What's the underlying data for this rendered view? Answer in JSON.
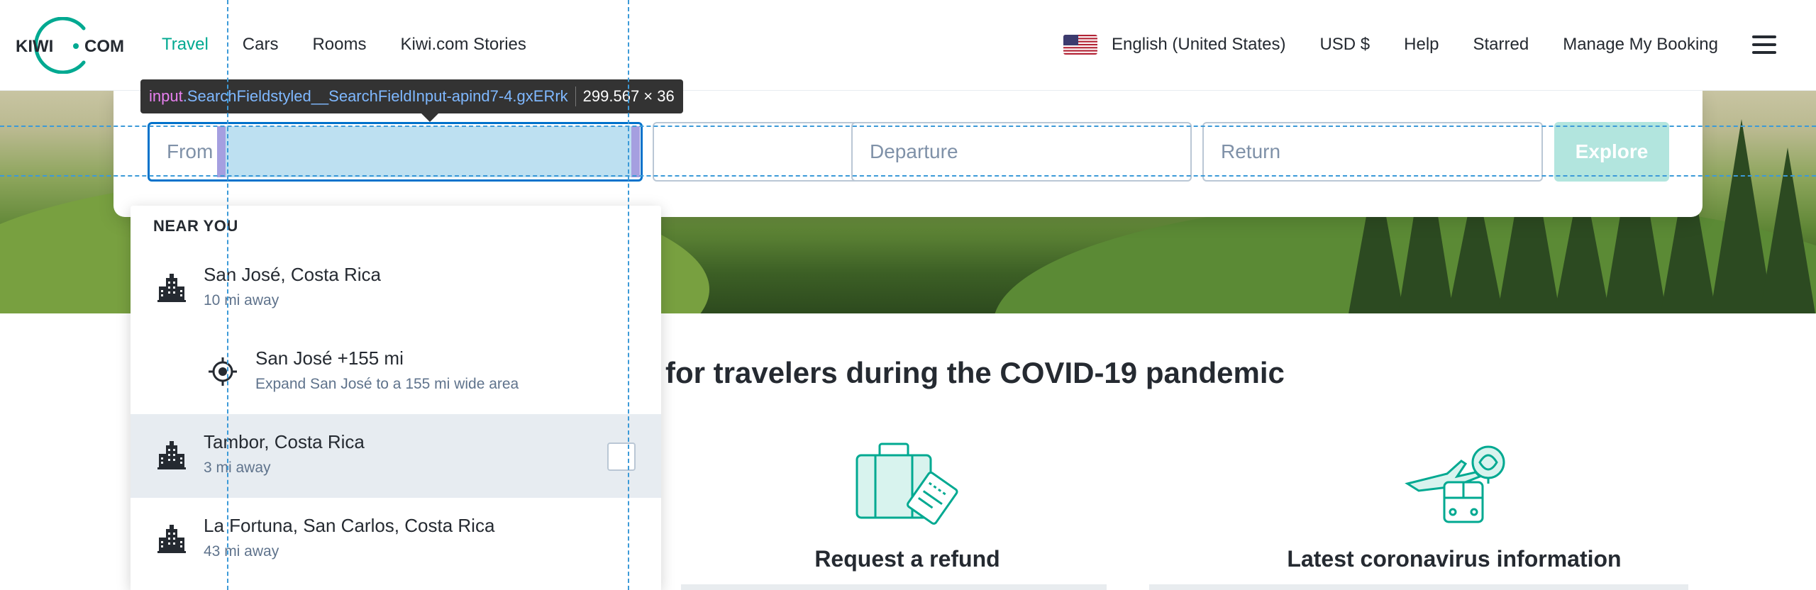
{
  "header": {
    "logo_text_left": "KIWI",
    "logo_text_right": "COM",
    "nav": [
      "Travel",
      "Cars",
      "Rooms",
      "Kiwi.com Stories"
    ],
    "active_nav": "Travel",
    "language": "English (United States)",
    "currency": "USD $",
    "help": "Help",
    "starred": "Starred",
    "manage": "Manage My Booking"
  },
  "search": {
    "from_label": "From",
    "departure_placeholder": "Departure",
    "return_placeholder": "Return",
    "explore_label": "Explore"
  },
  "devtools_tooltip": {
    "tag": "input",
    "class_name": ".SearchFieldstyled__SearchFieldInput-apind7-4.gxERrk",
    "size": "299.567 × 36"
  },
  "dropdown": {
    "heading": "NEAR YOU",
    "items": [
      {
        "title": "San José, Costa Rica",
        "subtitle": "10 mi away",
        "icon": "city-icon"
      },
      {
        "title": "San José +155 mi",
        "subtitle": "Expand San José to a 155 mi wide area",
        "icon": "location-target-icon"
      },
      {
        "title": "Tambor, Costa Rica",
        "subtitle": "3 mi away",
        "icon": "city-icon"
      },
      {
        "title": "La Fortuna, San Carlos, Costa Rica",
        "subtitle": "43 mi away",
        "icon": "city-icon"
      }
    ]
  },
  "content": {
    "covid_title": "for travelers during the COVID-19 pandemic",
    "cards": [
      {
        "title": "Request a refund",
        "icon": "suitcase-ticket-icon"
      },
      {
        "title": "Latest coronavirus information",
        "icon": "plane-bus-icon"
      }
    ]
  },
  "colors": {
    "brand": "#00a991",
    "focus": "#0172cb",
    "explore_disabled": "#b2e5de"
  }
}
